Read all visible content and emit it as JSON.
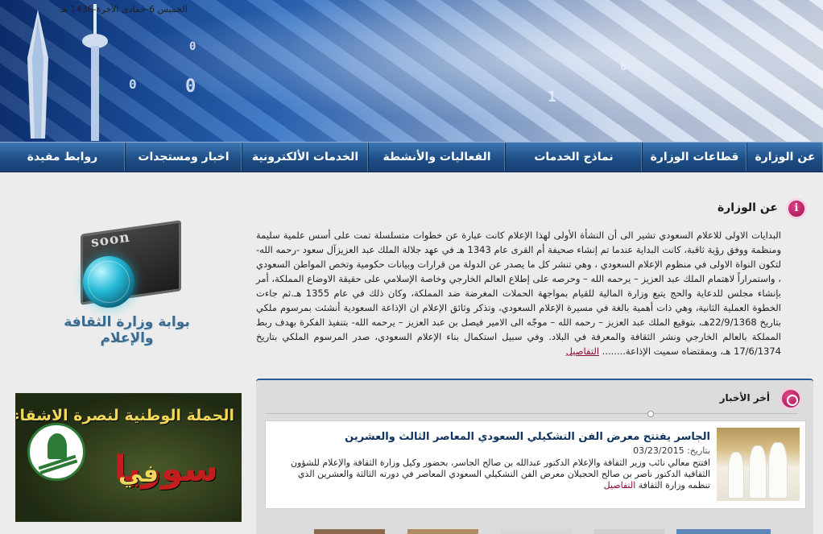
{
  "header": {
    "date": "الخميس 6-جمادى الأخرة-1436 هـ"
  },
  "nav": {
    "items": [
      {
        "label": "عن الوزارة",
        "width": 95
      },
      {
        "label": "قطاعات الوزارة",
        "width": 130
      },
      {
        "label": "نماذج الخدمات",
        "width": 170
      },
      {
        "label": "الفعاليات والأنشطة",
        "width": 170
      },
      {
        "label": "الخدمات الألكترونية",
        "width": 157
      },
      {
        "label": "اخبار ومستجدات",
        "width": 145
      },
      {
        "label": "روابط مفيدة",
        "width": 155
      }
    ]
  },
  "about": {
    "title": "عن الوزارة",
    "text": "البدايات الاولى للاعلام السعودي تشير الى أن النشأة الأولى لهذا الإعلام كانت عبارة عن خطوات متسلسلة تمت على أسس علمية سليمة ومنظمة ووفق رؤية ثاقبة، كانت البداية عندما تم إنشاء صحيفة أم القرى عام 1343 هـ في عهد جلالة الملك عبد العزيزآل سعود -رحمه الله- لتكون النواة الاولى في منظوم الإعلام السعودي ، وهي تنشر كل ما يصدر عن الدولة من قرارات وبيانات حكومية وتخص المواطن السعودي ، واستمراراً لاهتمام الملك عبد العزيز – يرحمه الله – وحرصه على إطلاع العالم الخارجي وخاصة الإسلامي على حقيقة الاوضاع المملكة، أمر بإنشاء مجلس للدعاية والحج يتبع وزارة المالية للقيام بمواجهة الحملات المغرضة ضد المملكة، وكان ذلك في عام 1355 هـ.ثم جاءت الخطوة العملية الثانية، وهي ذات أهمية بالغة في مسيرة الإعلام السعودي، وتذكر وثائق الإعلام ان الإذاعة السعودية أنشئت بمرسوم ملكي بتاريخ 22/9/1368هـ، بتوقيع الملك عبد العزيز – رحمه الله – موجّه الى الامير فيصل بن عبد العزيز – يرحمه الله- بتنفيذ الفكرة بهدف ربط المملكة بالعالم الخارجي ونشر الثقافة والمعرفة في البلاد. وفي سبيل استكمال بناء الإعلام السعودي، صدر المرسوم الملكي بتاريخ 17/6/1374 هـ، وبمقتضاه سميت الإذاعة........",
    "more": "التفاصيل"
  },
  "promo": {
    "soon": "soon",
    "portal_label": "بوابة وزارة الثقافة والإعلام"
  },
  "campaign": {
    "title": "الحملة الوطنية لنصرة الاشقاء",
    "fi": "في",
    "country": "سوريا"
  },
  "news": {
    "title": "أخر الأخبار",
    "items": [
      {
        "headline": "الجاسر يفتتح معرض الفن التشكيلي السعودي المعاصر الثالث والعشرين",
        "date_label": "بتاريخ:",
        "date": "03/23/2015",
        "body": "افتتح معالي نائب وزير الثقافة والإعلام الدكتور عبدالله بن صالح الجاسر، بحضور وكيل وزارة الثقافة والإعلام للشؤون الثقافية الدكتور ناصر بن صالح الحجيلان معرض الفن التشكيلي السعودي المعاصر في دورته الثالثة والعشرين الذي تنظمه وزارة الثقافة",
        "more": "التفاصيل"
      }
    ]
  },
  "colors": {
    "nav": "#1e4f87",
    "accent": "#a0104c",
    "link": "#8b0a3c",
    "headline": "#10325f"
  }
}
